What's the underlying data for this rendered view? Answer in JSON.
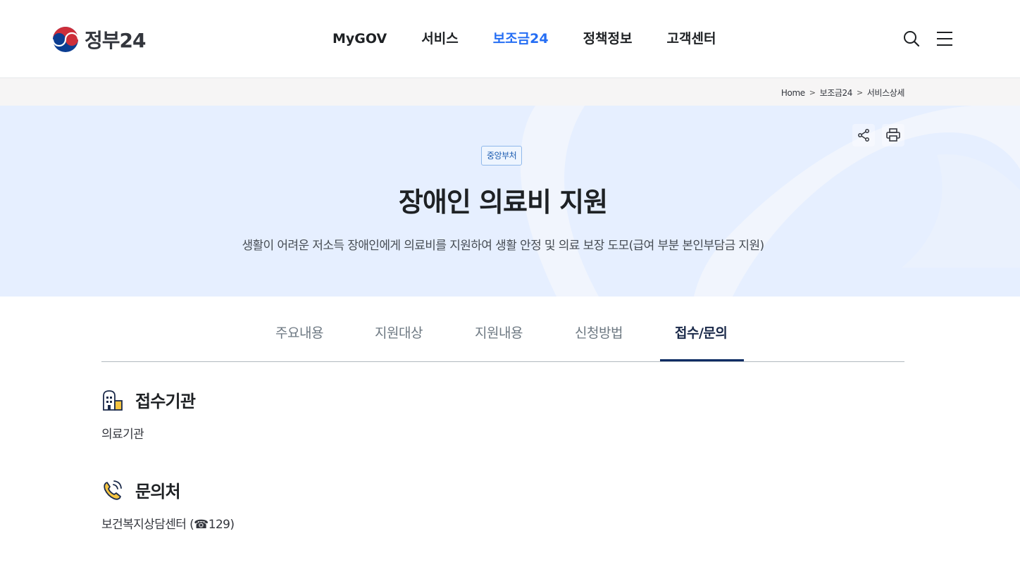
{
  "header": {
    "logo_text": "정부24",
    "nav": [
      "MyGOV",
      "서비스",
      "보조금24",
      "정책정보",
      "고객센터"
    ],
    "active_nav": "보조금24",
    "search_icon": "search-icon",
    "menu_icon": "hamburger-menu-icon"
  },
  "breadcrumb": {
    "items": [
      "Home",
      "보조금24",
      "서비스상세"
    ],
    "separator": ">"
  },
  "hero": {
    "badge": "중앙부처",
    "title": "장애인 의료비 지원",
    "description": "생활이 어려운 저소득 장애인에게 의료비를 지원하여 생활 안정 및 의료 보장 도모(급여 부분 본인부담금 지원)",
    "share_icon": "share-icon",
    "print_icon": "print-icon"
  },
  "tabs": {
    "items": [
      "주요내용",
      "지원대상",
      "지원내용",
      "신청방법",
      "접수/문의"
    ],
    "active": "접수/문의"
  },
  "sections": {
    "reception": {
      "title": "접수기관",
      "body": "의료기관",
      "icon": "building-icon"
    },
    "contact": {
      "title": "문의처",
      "body": "보건복지상담센터 (☎129)",
      "icon": "phone-icon"
    }
  },
  "colors": {
    "accent": "#256ef4",
    "hero_bg": "#e6efff",
    "active_tab": "#0b2b63",
    "badge_border": "#8fb8ea"
  }
}
